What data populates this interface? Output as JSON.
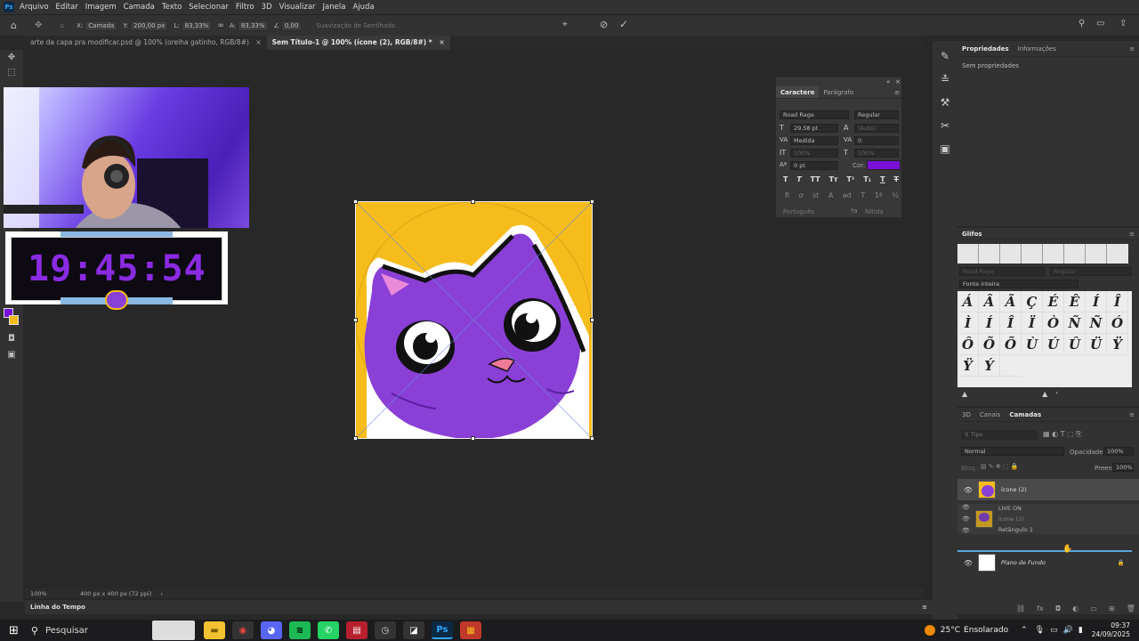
{
  "app": {
    "logo": "Ps"
  },
  "menu": [
    "Arquivo",
    "Editar",
    "Imagem",
    "Camada",
    "Texto",
    "Selecionar",
    "Filtro",
    "3D",
    "Visualizar",
    "Janela",
    "Ajuda"
  ],
  "options": {
    "x_label": "X:",
    "x_value": "Camada",
    "y_label": "Y:",
    "y_value": "200,00 px",
    "w_label": "L:",
    "w_value": "83,33%",
    "h_label": "A:",
    "h_value": "83,33%",
    "angle_value": "0,00",
    "interp_label": "Suavização de Serrilhado"
  },
  "tabs": [
    {
      "label": "arte da capa pra modificar.psd @ 100% (orelha gatinho, RGB/8#)",
      "close": "×"
    },
    {
      "label": "Sem Título-1 @ 100% (ícone (2), RGB/8#) *",
      "close": "×"
    }
  ],
  "status": {
    "zoom": "100%",
    "doc": "400 px x 400 px (72 ppi)"
  },
  "timeline": {
    "label": "Linha do Tempo"
  },
  "clock": {
    "time": "19:45:54"
  },
  "character_panel": {
    "tab_character": "Caractere",
    "tab_paragraph": "Parágrafo",
    "font": "Road Rage",
    "style": "Regular",
    "size": "29,58 pt",
    "leading": "(Auto)",
    "kerning": "Medida",
    "tracking": "0",
    "vscale": "100%",
    "hscale": "100%",
    "baseline": "0 pt",
    "color_label": "Cor:",
    "color": "#7a10d8",
    "language": "Português",
    "antialias": "Nítida"
  },
  "properties": {
    "tab_properties": "Propriedades",
    "tab_info": "Informações",
    "empty": "Sem propriedades"
  },
  "glyphs": {
    "title": "Glifos",
    "font": "Road Rage",
    "style": "Regular",
    "filter": "Fonte inteira",
    "rows": [
      [
        "Á",
        "Â",
        "Ã",
        "Ç",
        "É",
        "Ê",
        "Í",
        "Î"
      ],
      [
        "Ì",
        "Í",
        "Î",
        "Ï",
        "Ò",
        "Ñ",
        "Ñ",
        "Ó"
      ],
      [
        "Ô",
        "Õ",
        "Õ",
        "Ù",
        "Ú",
        "Û",
        "Ü",
        "Ÿ"
      ],
      [
        "Ÿ",
        "Ý"
      ]
    ]
  },
  "layers": {
    "tab_3d": "3D",
    "tab_channels": "Canais",
    "tab_layers": "Camadas",
    "search_placeholder": "Tipo",
    "blend_mode": "Normal",
    "opacity_label": "Opacidade:",
    "opacity": "100%",
    "lock_label": "Bloq.:",
    "fill_label": "Preen.:",
    "fill": "100%",
    "items": [
      {
        "name": "ícone (2)",
        "visible": true
      },
      {
        "name": "LIVE ON",
        "visible": true
      },
      {
        "name": "ícone (2)",
        "visible": true
      },
      {
        "name": "Retângulo 1",
        "visible": true
      },
      {
        "name": "Plano de Fundo",
        "visible": true,
        "locked": true
      }
    ]
  },
  "taskbar": {
    "search_label": "Pesquisar",
    "weather_temp": "25°C",
    "weather_text": "Ensolarado",
    "time": "09:37",
    "date": "24/09/2025",
    "apps": [
      "file-explorer-icon",
      "chrome-icon",
      "discord-icon",
      "spotify-icon",
      "whatsapp-icon",
      "winrar-icon",
      "clock-icon",
      "capcut-icon",
      "photoshop-icon",
      "stack-icon"
    ]
  },
  "colors": {
    "accent": "#31a8ff",
    "artboard_bg": "#f5bc1c",
    "cat_purple": "#8a3fd6",
    "fg_swatch": "#7a10d8",
    "bg_swatch": "#f5bc1c"
  }
}
